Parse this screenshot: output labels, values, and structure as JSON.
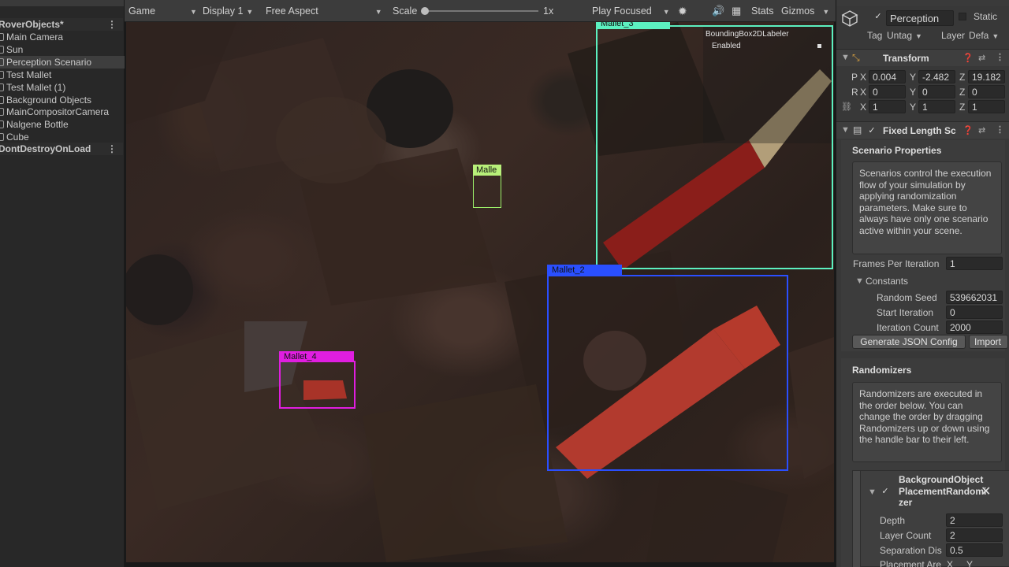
{
  "hierarchy": {
    "root_label": "RoverObjects*",
    "items": [
      {
        "label": "Main Camera"
      },
      {
        "label": "Sun"
      },
      {
        "label": "Perception Scenario"
      },
      {
        "label": "Test Mallet"
      },
      {
        "label": "Test Mallet (1)"
      },
      {
        "label": "Background Objects"
      },
      {
        "label": "MainCompositorCamera"
      },
      {
        "label": "Nalgene Bottle"
      },
      {
        "label": "Cube"
      }
    ],
    "dont_destroy_label": "DontDestroyOnLoad",
    "more_icon": "⋮"
  },
  "game_toolbar": {
    "view_label": "Game",
    "display_label": "Display 1",
    "aspect_label": "Free Aspect",
    "scale_label": "Scale",
    "scale_value": "1x",
    "play_mode_label": "Play Focused",
    "stats_label": "Stats",
    "gizmos_label": "Gizmos"
  },
  "game_view": {
    "boxes": [
      {
        "label": "Mallet_3",
        "color": "#5cf0c0"
      },
      {
        "label": "Malle",
        "color": "#9cf06a"
      },
      {
        "label": "Mallet_2",
        "color": "#2a4fff"
      },
      {
        "label": "Mallet_4",
        "color": "#e01ee0"
      }
    ],
    "labeler_title": "BoundingBox2DLabeler",
    "labeler_status": "Enabled"
  },
  "inspector": {
    "object_name": "Perception",
    "static_label": "Static",
    "tag_label": "Tag",
    "tag_value": "Untag",
    "layer_label": "Layer",
    "layer_value": "Defa",
    "transform": {
      "title": "Transform",
      "p_label": "P",
      "r_label": "R",
      "s_label": "",
      "px": "0.004",
      "py": "-2.482",
      "pz": "19.182",
      "rx": "0",
      "ry": "0",
      "rz": "0",
      "sx": "1",
      "sy": "1",
      "sz": "1"
    },
    "scenario": {
      "title": "Fixed Length Sc",
      "properties_header": "Scenario Properties",
      "help_text": "Scenarios control the execution flow of your simulation by applying randomization parameters. Make sure to always have only one scenario active within your scene.",
      "frames_label": "Frames Per Iteration",
      "frames_value": "1",
      "constants_label": "Constants",
      "random_seed_label": "Random Seed",
      "random_seed_value": "539662031",
      "start_iter_label": "Start Iteration",
      "start_iter_value": "0",
      "iter_count_label": "Iteration Count",
      "iter_count_value": "2000",
      "gen_json_button": "Generate JSON Config",
      "import_button": "Import"
    },
    "randomizers": {
      "header": "Randomizers",
      "help_text": "Randomizers are executed in the order below. You can change the order by dragging Randomizers up or down using the handle bar to their left.",
      "item_title": "BackgroundObjectPlacementRandomizer",
      "depth_label": "Depth",
      "depth_value": "2",
      "layer_count_label": "Layer Count",
      "layer_count_value": "2",
      "separation_label": "Separation Dis",
      "separation_value": "0.5",
      "placement_label": "Placement Are",
      "placement_x": "X",
      "placement_y": "Y"
    }
  }
}
